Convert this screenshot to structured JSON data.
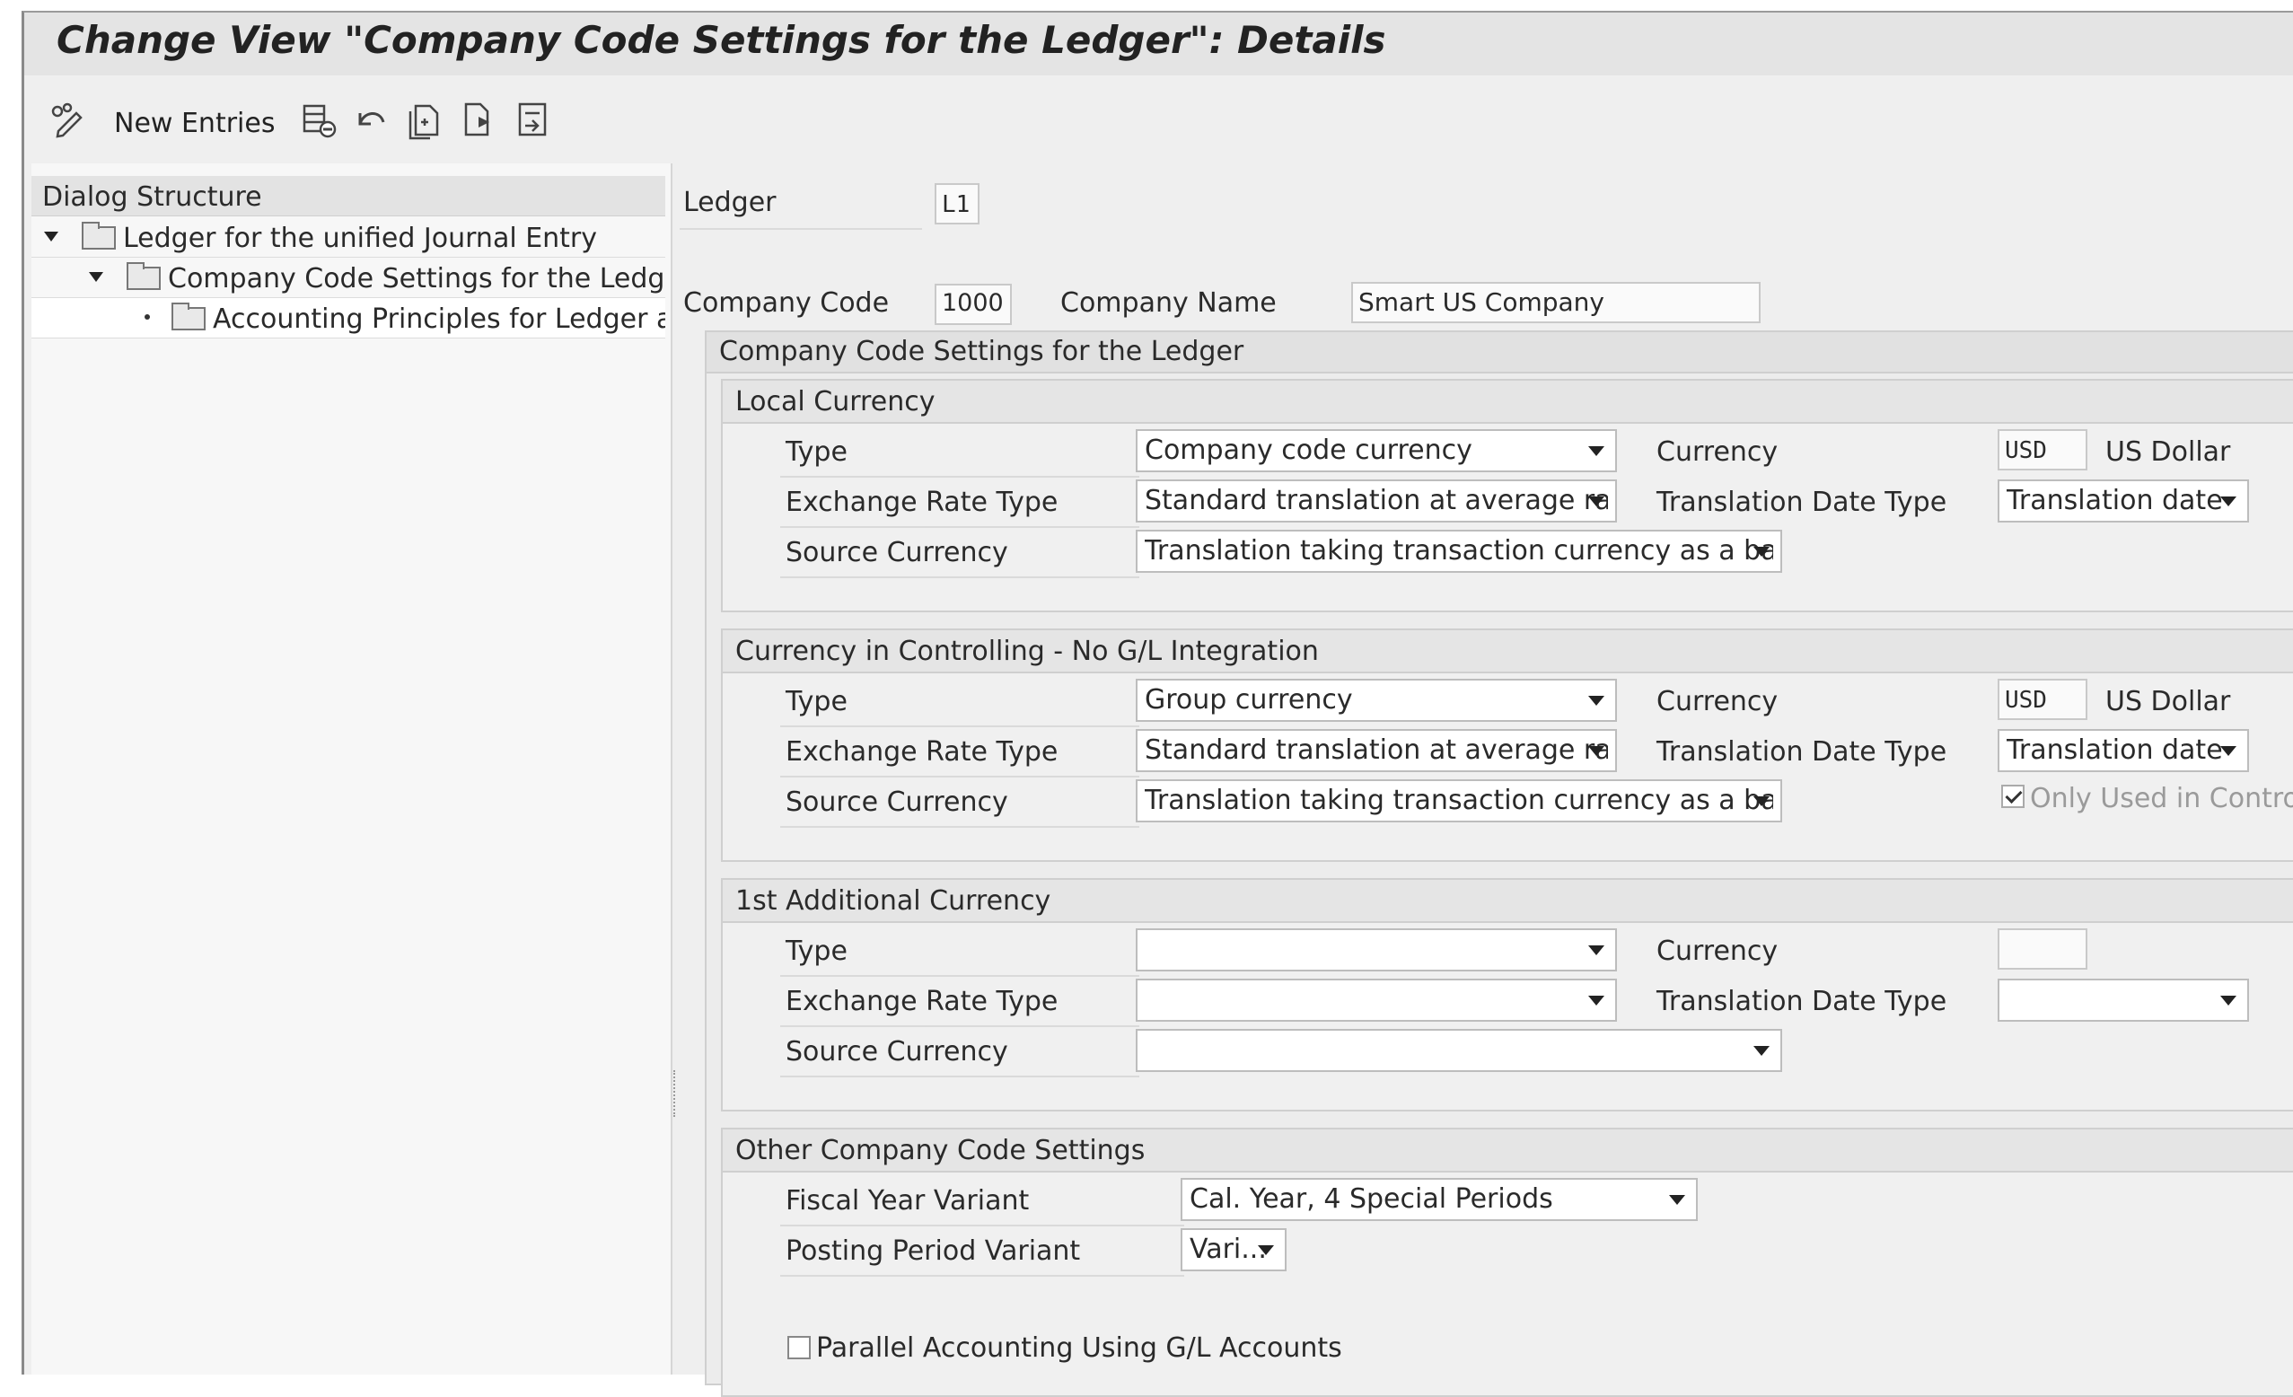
{
  "window": {
    "title": "Change View \"Company Code Settings for the Ledger\": Details"
  },
  "toolbar": {
    "new_entries_label": "New Entries",
    "icons": [
      "edit-toggle-icon",
      "delete-icon",
      "undo-icon",
      "copy-icon",
      "previous-entry-icon",
      "next-entry-icon"
    ]
  },
  "dialog_structure": {
    "header": "Dialog Structure",
    "items": [
      {
        "label": "Ledger for the unified Journal Entry",
        "level": 0,
        "expanded": true
      },
      {
        "label": "Company Code Settings for the Ledger",
        "level": 1,
        "expanded": true,
        "open_folder": true
      },
      {
        "label": "Accounting Principles for Ledger anc",
        "level": 2,
        "selected": true
      }
    ]
  },
  "header": {
    "ledger_label": "Ledger",
    "ledger_value": "L1",
    "company_code_label": "Company Code",
    "company_code_value": "1000",
    "company_name_label": "Company Name",
    "company_name_value": "Smart US Company"
  },
  "settings": {
    "title": "Company Code Settings for the Ledger",
    "local_currency": {
      "title": "Local Currency",
      "type_label": "Type",
      "type_value": "Company code currency",
      "exchange_rate_type_label": "Exchange Rate Type",
      "exchange_rate_type_value": "Standard translation at average rat...",
      "source_currency_label": "Source Currency",
      "source_currency_value": "Translation taking transaction currency as a basis",
      "currency_label": "Currency",
      "currency_value": "USD",
      "currency_name": "US Dollar",
      "translation_date_type_label": "Translation Date Type",
      "translation_date_type_value": "Translation date"
    },
    "controlling_currency": {
      "title": "Currency in Controlling - No G/L Integration",
      "type_label": "Type",
      "type_value": "Group currency",
      "exchange_rate_type_label": "Exchange Rate Type",
      "exchange_rate_type_value": "Standard translation at average rat...",
      "source_currency_label": "Source Currency",
      "source_currency_value": "Translation taking transaction currency as a basis",
      "currency_label": "Currency",
      "currency_value": "USD",
      "currency_name": "US Dollar",
      "translation_date_type_label": "Translation Date Type",
      "translation_date_type_value": "Translation date",
      "only_used_in_controlling_label": "Only Used in Controlling",
      "only_used_in_controlling_checked": true
    },
    "first_additional_currency": {
      "title": "1st Additional Currency",
      "type_label": "Type",
      "type_value": "",
      "exchange_rate_type_label": "Exchange Rate Type",
      "exchange_rate_type_value": "",
      "source_currency_label": "Source Currency",
      "source_currency_value": "",
      "currency_label": "Currency",
      "currency_value": "",
      "translation_date_type_label": "Translation Date Type",
      "translation_date_type_value": ""
    },
    "other_settings": {
      "title": "Other Company Code Settings",
      "fiscal_year_variant_label": "Fiscal Year Variant",
      "fiscal_year_variant_value": "Cal. Year, 4 Special Periods",
      "posting_period_variant_label": "Posting Period Variant",
      "posting_period_variant_value": "Vari...",
      "parallel_accounting_label": "Parallel Accounting Using G/L Accounts",
      "parallel_accounting_checked": false
    }
  }
}
